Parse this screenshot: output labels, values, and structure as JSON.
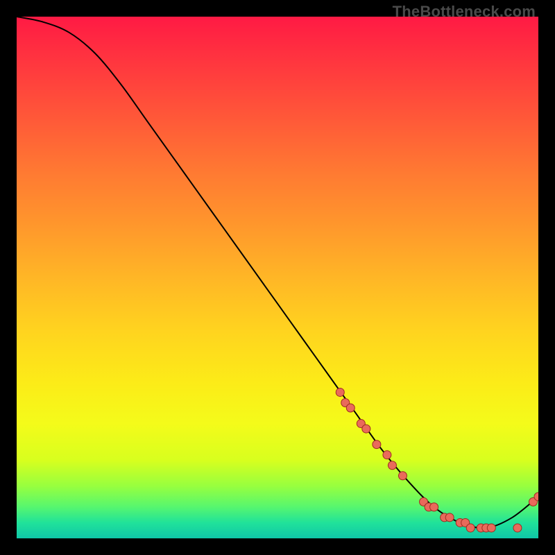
{
  "watermark": "TheBottleneck.com",
  "chart_data": {
    "type": "line",
    "title": "",
    "xlabel": "",
    "ylabel": "",
    "xlim": [
      0,
      100
    ],
    "ylim": [
      0,
      100
    ],
    "grid": false,
    "series": [
      {
        "name": "curve",
        "x": [
          0,
          5,
          10,
          15,
          20,
          25,
          30,
          35,
          40,
          45,
          50,
          55,
          60,
          65,
          70,
          75,
          80,
          85,
          90,
          95,
          100
        ],
        "y": [
          100,
          99,
          97,
          93,
          87,
          80,
          73,
          66,
          59,
          52,
          45,
          38,
          31,
          24,
          17,
          11,
          6,
          3,
          2,
          4,
          8
        ],
        "style": "line"
      },
      {
        "name": "markers",
        "x": [
          62,
          63,
          64,
          66,
          67,
          69,
          71,
          72,
          74,
          78,
          79,
          80,
          82,
          83,
          85,
          86,
          87,
          89,
          90,
          91,
          96,
          99,
          100
        ],
        "y": [
          28,
          26,
          25,
          22,
          21,
          18,
          16,
          14,
          12,
          7,
          6,
          6,
          4,
          4,
          3,
          3,
          2,
          2,
          2,
          2,
          2,
          7,
          8
        ],
        "style": "scatter"
      }
    ],
    "colors": {
      "curve": "#000000",
      "marker_fill": "#e96a5b",
      "marker_stroke": "#9e2b20"
    }
  }
}
